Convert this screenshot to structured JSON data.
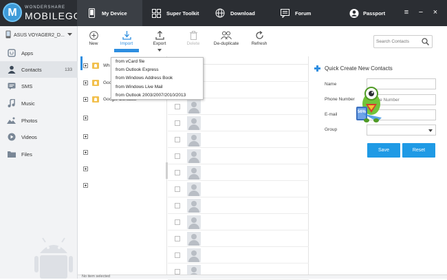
{
  "app": {
    "logo_top": "WONDERSHARE",
    "logo_bottom": "MOBILEGO",
    "logo_letter": "M"
  },
  "topnav": {
    "tabs": [
      {
        "label": "My Device",
        "icon": "phone-icon",
        "active": true
      },
      {
        "label": "Super Toolkit",
        "icon": "grid-icon"
      },
      {
        "label": "Download",
        "icon": "globe-icon"
      },
      {
        "label": "Forum",
        "icon": "forum-icon"
      }
    ],
    "passport": "Passport",
    "menu_icon": "≡",
    "minimize_icon": "−",
    "close_icon": "×"
  },
  "sidebar": {
    "device_name": "ASUS VOYAGER2_D...",
    "items": [
      {
        "label": "Apps",
        "icon": "apps-icon"
      },
      {
        "label": "Contacts",
        "icon": "contacts-icon",
        "count": "133",
        "active": true
      },
      {
        "label": "SMS",
        "icon": "sms-icon"
      },
      {
        "label": "Music",
        "icon": "music-icon"
      },
      {
        "label": "Photos",
        "icon": "photos-icon"
      },
      {
        "label": "Videos",
        "icon": "videos-icon"
      },
      {
        "label": "Files",
        "icon": "files-icon"
      }
    ]
  },
  "toolbar": {
    "new": "New",
    "import": "Import",
    "export": "Export",
    "delete": "Delete",
    "deduplicate": "De-duplicate",
    "refresh": "Refresh",
    "search_placeholder": "Search Contacts"
  },
  "import_menu": {
    "items": [
      "from vCard file",
      "from Outlook Express",
      "from Windows Address Book",
      "from Windows Live Mail",
      "from Outlook 2003/2007/2010/2013"
    ]
  },
  "groups": {
    "rows": [
      "Wh",
      "Goo",
      "Google Contacts"
    ],
    "collapsed_count": 6
  },
  "quick_create": {
    "title": "Quick Create New Contacts",
    "name_label": "Name",
    "phone_label": "Phone Number",
    "phone_placeholder": "Phone Number",
    "email_label": "E-mail",
    "group_label": "Group",
    "save": "Save",
    "reset": "Reset"
  },
  "mascot": {
    "badge": "56%"
  },
  "status": {
    "text": "No item selected"
  },
  "colors": {
    "topbar": "#2b2e33",
    "accent": "#1f9ae5",
    "sidebar": "#f2f3f5"
  }
}
